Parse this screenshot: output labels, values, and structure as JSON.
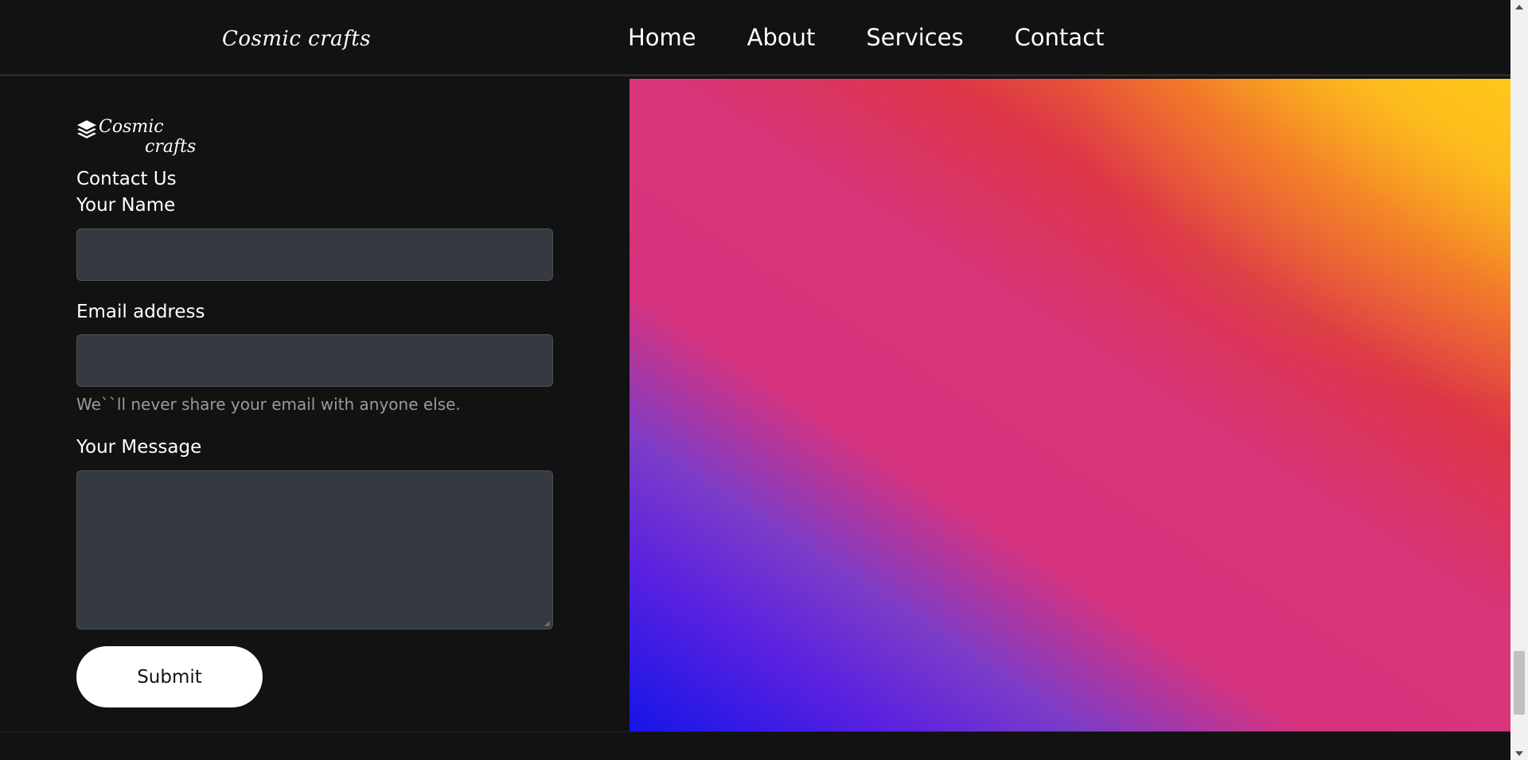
{
  "navbar": {
    "brand": "Cosmic crafts",
    "links": [
      "Home",
      "About",
      "Services",
      "Contact"
    ]
  },
  "contact": {
    "logo_word_1": "Cosmic",
    "logo_word_2": "crafts",
    "heading": "Contact Us",
    "name_label": "Your Name",
    "name_value": "",
    "email_label": "Email address",
    "email_value": "",
    "email_help": "We``ll never share your email with anyone else.",
    "message_label": "Your Message",
    "message_value": "",
    "submit_label": "Submit"
  },
  "colors": {
    "background": "#121212",
    "input_bg": "#343a40",
    "gradient_start": "#1515e8",
    "gradient_mid": "#d6337e",
    "gradient_end": "#ffc414"
  },
  "icons": {
    "logo": "layers-icon",
    "scroll_up": "triangle-up-icon",
    "scroll_down": "triangle-down-icon"
  }
}
